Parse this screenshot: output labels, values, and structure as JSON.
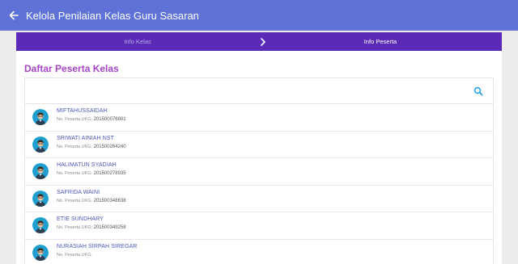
{
  "appbar": {
    "title": "Kelola Penilaian Kelas Guru Sasaran"
  },
  "stepper": {
    "steps": [
      {
        "label": "Info Kelas"
      },
      {
        "label": "Info Peserta"
      }
    ]
  },
  "main": {
    "section_title": "Daftar Peserta Kelas",
    "search": {
      "placeholder": "",
      "value": ""
    },
    "participant_label": "No. Peserta UKG:",
    "participants": [
      {
        "name": "MIFTAHUSSAIDAH",
        "number": "201500076801"
      },
      {
        "name": "SRIWATI AINIAH NST",
        "number": "201500264240"
      },
      {
        "name": "HALIMATUN SYADIAH",
        "number": "201500278935"
      },
      {
        "name": "SAFRIDA WAINI",
        "number": "201500348638"
      },
      {
        "name": "ETIE SUNDHARY",
        "number": "201500349258"
      },
      {
        "name": "NURASIAH SIRPAH SIREGAR",
        "number": ""
      }
    ]
  },
  "colors": {
    "appbar": "#5e72d8",
    "stepper": "#5b2bb8",
    "section_title": "#a844c6",
    "name": "#4a56b8",
    "search_icon": "#2aa4e6",
    "avatar_bg": "#1f9fcf"
  },
  "icons": {
    "back": "arrow-left-icon",
    "stepper_sep": "chevron-right-icon",
    "search": "search-icon",
    "avatar": "teacher-avatar-icon"
  }
}
